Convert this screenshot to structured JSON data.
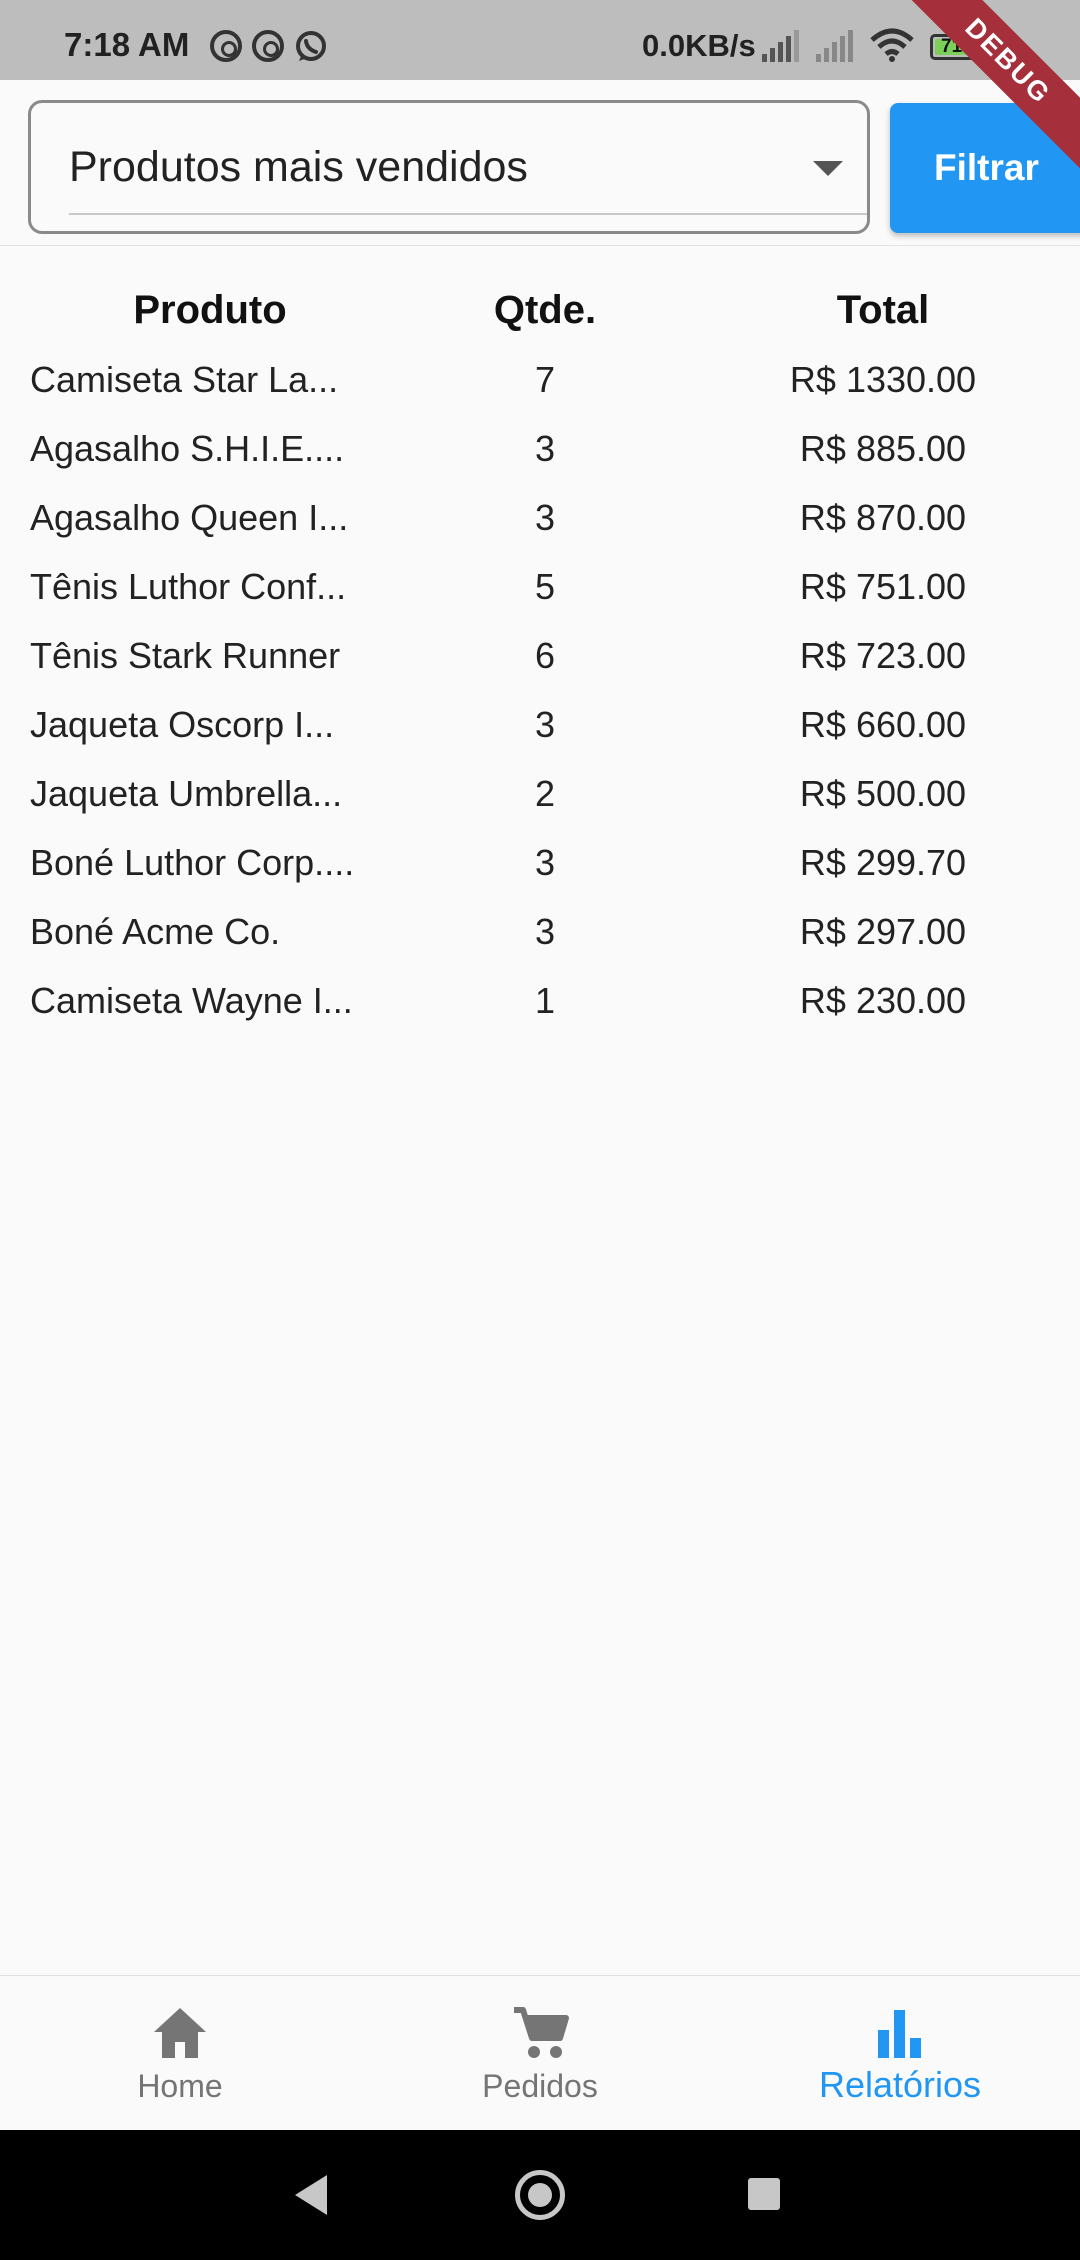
{
  "status_bar": {
    "time": "7:18 AM",
    "speed": "0.0KB/s",
    "battery": "71",
    "debug_label": "DEBUG"
  },
  "filter": {
    "selected": "Produtos mais vendidos",
    "button_label": "Filtrar"
  },
  "table": {
    "headers": [
      "Produto",
      "Qtde.",
      "Total"
    ],
    "rows": [
      {
        "produto": "Camiseta Star La...",
        "qtde": "7",
        "total": "R$ 1330.00"
      },
      {
        "produto": "Agasalho S.H.I.E....",
        "qtde": "3",
        "total": "R$ 885.00"
      },
      {
        "produto": "Agasalho Queen I...",
        "qtde": "3",
        "total": "R$ 870.00"
      },
      {
        "produto": "Tênis Luthor Conf...",
        "qtde": "5",
        "total": "R$ 751.00"
      },
      {
        "produto": "Tênis Stark Runner",
        "qtde": "6",
        "total": "R$ 723.00"
      },
      {
        "produto": "Jaqueta Oscorp I...",
        "qtde": "3",
        "total": "R$ 660.00"
      },
      {
        "produto": "Jaqueta Umbrella...",
        "qtde": "2",
        "total": "R$ 500.00"
      },
      {
        "produto": "Boné Luthor Corp....",
        "qtde": "3",
        "total": "R$ 299.70"
      },
      {
        "produto": "Boné Acme Co.",
        "qtde": "3",
        "total": "R$ 297.00"
      },
      {
        "produto": "Camiseta Wayne I...",
        "qtde": "1",
        "total": "R$ 230.00"
      }
    ]
  },
  "bottom_nav": {
    "items": [
      {
        "label": "Home",
        "icon": "home-icon"
      },
      {
        "label": "Pedidos",
        "icon": "cart-icon"
      },
      {
        "label": "Relatórios",
        "icon": "bar-chart-icon"
      }
    ],
    "active_color": "#2196f3",
    "inactive_color": "#757575"
  }
}
